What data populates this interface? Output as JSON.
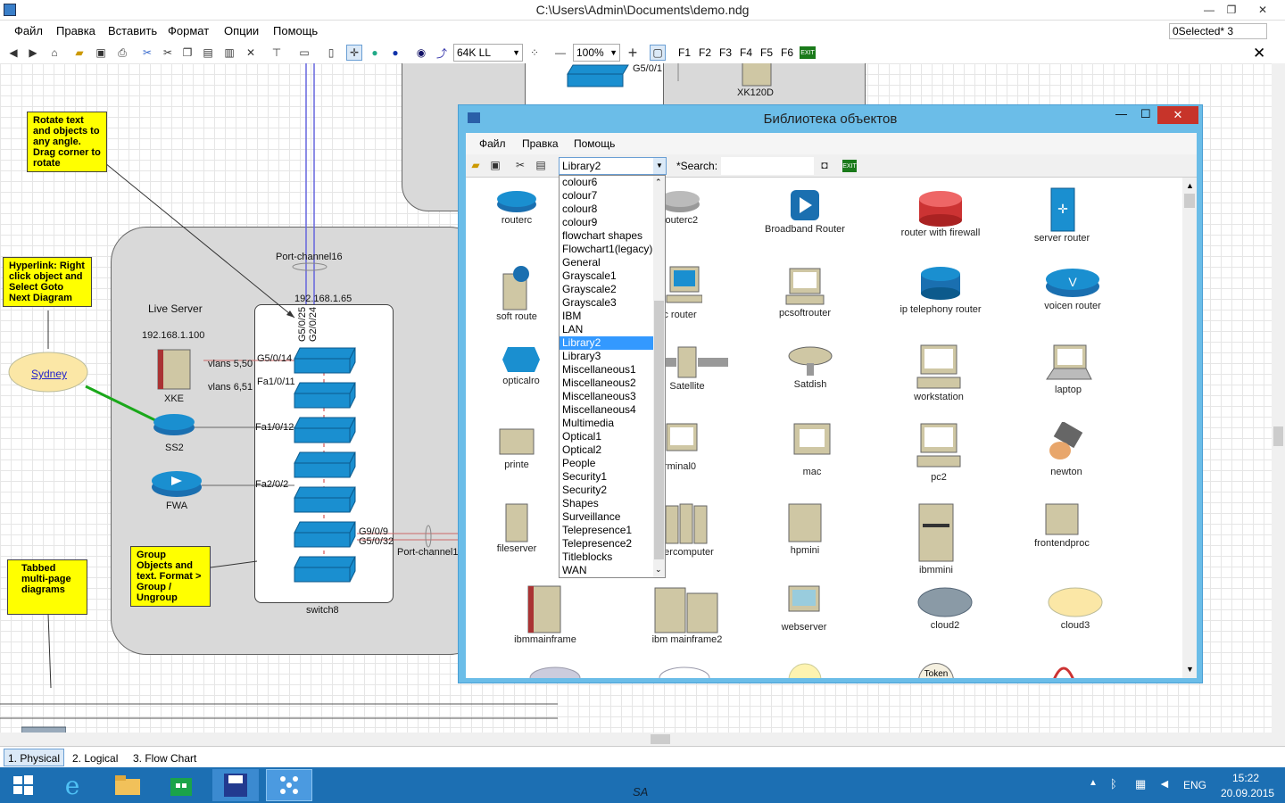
{
  "window": {
    "title": "C:\\Users\\Admin\\Documents\\demo.ndg",
    "min": "—",
    "max": "❐",
    "close": "✕"
  },
  "menu": [
    "Файл",
    "Правка",
    "Вставить",
    "Формат",
    "Опции",
    "Помощь"
  ],
  "selected_box": "0Selected* 3",
  "toolbar": {
    "line_combo": "64K LL",
    "zoom": "100%",
    "fkeys": [
      "F1",
      "F2",
      "F3",
      "F4",
      "F5",
      "F6"
    ],
    "exit": "EXIT"
  },
  "canvas": {
    "notes": [
      "Rotate text and objects to any angle. Drag corner to rotate",
      "Hyperlink: Right click object and Select Goto Next Diagram",
      "Group Objects and text. Format > Group / Ungroup",
      "Tabbed multi-page diagrams"
    ],
    "cloud_link": "Sydney",
    "labels": {
      "port_channel": "Port-channel16",
      "ip1": "192.168.1.65",
      "ip2": "192.168.1.100",
      "live_server": "Live Server",
      "xke": "XKE",
      "ss2": "SS2",
      "fwa": "FWA",
      "switch8": "switch8",
      "vlans1": "vlans 5,50",
      "vlans2": "vlans 6,51",
      "p1": "G5/0/14",
      "p2": "Fa1/0/11",
      "p3": "Fa1/0/12",
      "p4": "Fa2/0/2",
      "p5": "G9/0/9",
      "p6": "G5/0/32",
      "pv1": "G5/0/25",
      "pv2": "G2/0/24",
      "port_channel2": "Port-channel1",
      "xk120d": "XK120D",
      "g501": "G5/0/1"
    }
  },
  "library": {
    "title": "Библиотека объектов",
    "menu": [
      "Файл",
      "Правка",
      "Помощь"
    ],
    "library_select": "Library2",
    "search_label": "*Search:",
    "exit": "EXIT",
    "dropdown": [
      "colour6",
      "colour7",
      "colour8",
      "colour9",
      "flowchart shapes",
      "Flowchart1(legacy)",
      "General",
      "Grayscale1",
      "Grayscale2",
      "Grayscale3",
      "IBM",
      "LAN",
      "Library2",
      "Library3",
      "Miscellaneous1",
      "Miscellaneous2",
      "Miscellaneous3",
      "Miscellaneous4",
      "Multimedia",
      "Optical1",
      "Optical2",
      "People",
      "Security1",
      "Security2",
      "Shapes",
      "Surveillance",
      "Telepresence1",
      "Telepresence2",
      "Titleblocks",
      "WAN"
    ],
    "objects": [
      "routerc",
      "routerc2",
      "Broadband Router",
      "router with firewall",
      "server router",
      "soft route",
      "c router",
      "pcsoftrouter",
      "ip telephony router",
      "voicen router",
      "opticalro",
      "Satellite",
      "Satdish",
      "workstation",
      "laptop",
      "printe",
      "rminal0",
      "mac",
      "pc2",
      "newton",
      "fileserver",
      "ercomputer",
      "hpmini",
      "ibmmini",
      "frontendproc",
      "ibmmainframe",
      "ibm mainframe2",
      "webserver",
      "cloud2",
      "cloud3",
      "Token"
    ]
  },
  "tabs": [
    "1. Physical",
    "2. Logical",
    "3. Flow Chart"
  ],
  "taskbar": {
    "lang": "ENG",
    "time": "15:22",
    "date": "20.09.2015",
    "center": "SA"
  },
  "colors": {
    "taskbar": "#1c6fb3",
    "switch": "#1a8fd0",
    "note": "#ffff00",
    "libframe": "#6bbde8"
  }
}
